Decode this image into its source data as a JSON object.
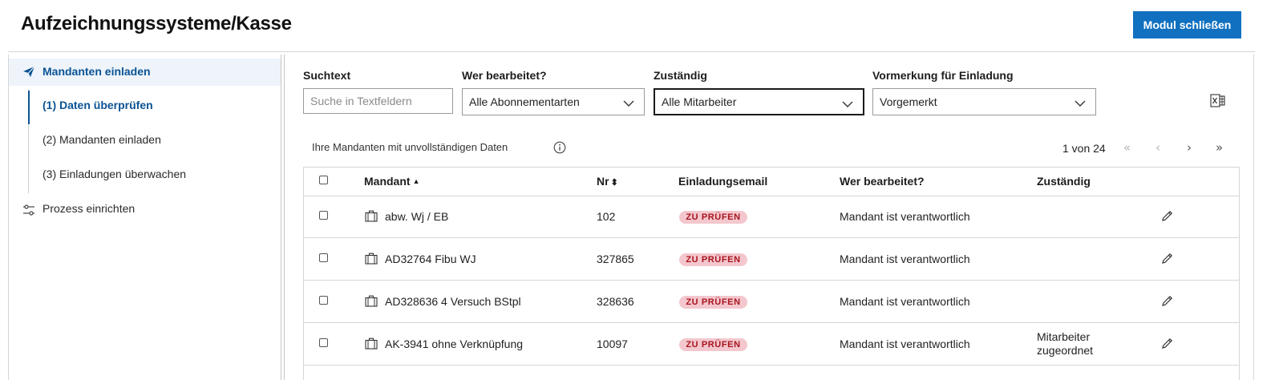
{
  "header": {
    "title": "Aufzeichnungssysteme/Kasse",
    "close_button": "Modul schließen",
    "accent_color": "#1170c0"
  },
  "sidebar": {
    "main_item": {
      "label": "Mandanten einladen",
      "icon": "paper-plane-icon"
    },
    "sub_items": [
      {
        "label": "(1) Daten überprüfen",
        "active": true
      },
      {
        "label": "(2) Mandanten einladen",
        "active": false
      },
      {
        "label": "(3) Einladungen überwachen",
        "active": false
      }
    ],
    "setup_item": {
      "label": "Prozess einrichten",
      "icon": "sliders-icon"
    }
  },
  "filters": {
    "search": {
      "label": "Suchtext",
      "placeholder": "Suche in Textfeldern",
      "value": ""
    },
    "editor": {
      "label": "Wer bearbeitet?",
      "value": "Alle Abonnementarten"
    },
    "responsible": {
      "label": "Zuständig",
      "value": "Alle Mitarbeiter"
    },
    "marking": {
      "label": "Vormerkung für Einladung",
      "value": "Vorgemerkt"
    },
    "export_icon": "excel-export-icon"
  },
  "table": {
    "caption": "Ihre Mandanten mit unvollständigen Daten",
    "pager": {
      "text": "1 von 24",
      "first": "«",
      "prev": "‹",
      "next": "›",
      "last": "»"
    },
    "columns": {
      "client": "Mandant",
      "client_sort": "▲",
      "nr": "Nr",
      "nr_sort": "⬍",
      "email": "Einladungsemail",
      "editor": "Wer bearbeitet?",
      "responsible": "Zuständig"
    },
    "rows": [
      {
        "client": "abw. Wj / EB",
        "nr": "102",
        "email": "ZU PRÜFEN",
        "editor": "Mandant ist verantwortlich",
        "responsible": ""
      },
      {
        "client": "AD32764 Fibu WJ",
        "nr": "327865",
        "email": "ZU PRÜFEN",
        "editor": "Mandant ist verantwortlich",
        "responsible": ""
      },
      {
        "client": "AD328636 4 Versuch BStpl",
        "nr": "328636",
        "email": "ZU PRÜFEN",
        "editor": "Mandant ist verantwortlich",
        "responsible": ""
      },
      {
        "client": "AK-3941 ohne Verknüpfung",
        "nr": "10097",
        "email": "ZU PRÜFEN",
        "editor": "Mandant ist verantwortlich",
        "responsible_line1": "Mitarbeiter",
        "responsible_line2": "zugeordnet"
      }
    ],
    "badge_bg": "#f3c7cd",
    "badge_fg": "#a8141e"
  }
}
